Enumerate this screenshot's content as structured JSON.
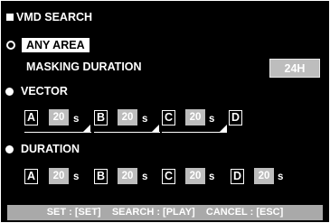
{
  "title": "VMD SEARCH",
  "any_area_label": "ANY AREA",
  "masking_duration": {
    "label": "MASKING DURATION",
    "value": "24H"
  },
  "vector": {
    "label": "VECTOR",
    "areas": [
      {
        "letter": "A",
        "value": "20",
        "unit": "s"
      },
      {
        "letter": "B",
        "value": "20",
        "unit": "s"
      },
      {
        "letter": "C",
        "value": "20",
        "unit": "s"
      },
      {
        "letter": "D"
      }
    ]
  },
  "duration": {
    "label": "DURATION",
    "areas": [
      {
        "letter": "A",
        "value": "20",
        "unit": "s"
      },
      {
        "letter": "B",
        "value": "20",
        "unit": "s"
      },
      {
        "letter": "C",
        "value": "20",
        "unit": "s"
      },
      {
        "letter": "D",
        "value": "20",
        "unit": "s"
      }
    ]
  },
  "footer_hint": "SET : [SET]    SEARCH : [PLAY]    CANCEL : [ESC]",
  "colors": {
    "background": "#000000",
    "text": "#ffffff",
    "value_box": "#bdbdbd",
    "footer": "#a9a9a9"
  }
}
